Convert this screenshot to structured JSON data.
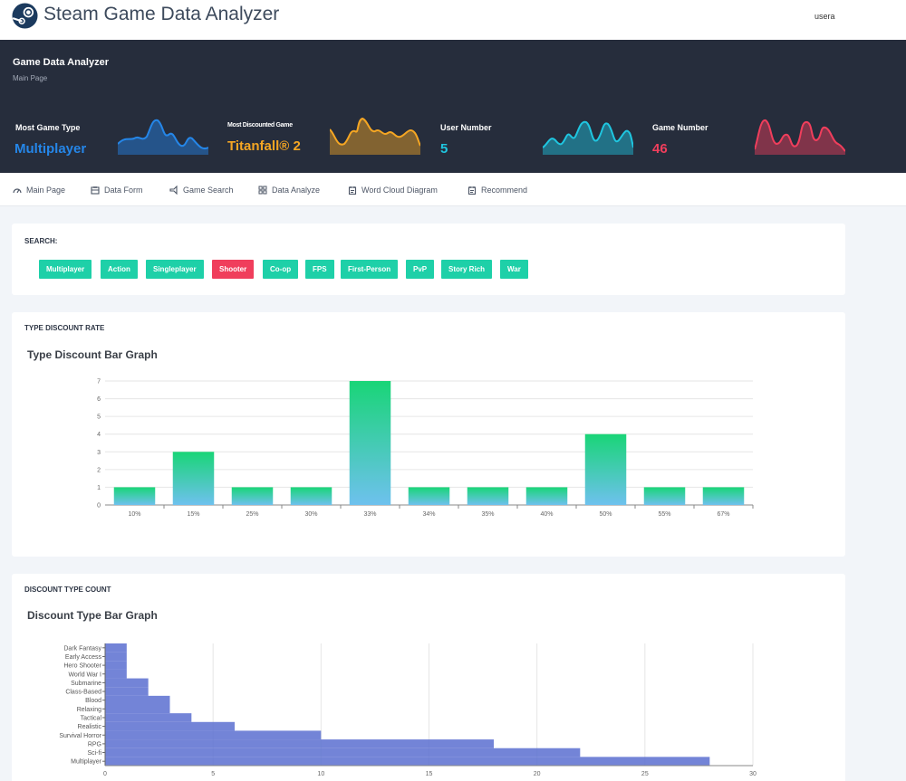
{
  "app": {
    "title": "Steam Game Data Analyzer",
    "user": "usera"
  },
  "hero": {
    "title": "Game Data Analyzer",
    "subtitle": "Main Page",
    "stats": [
      {
        "label": "Most Game Type",
        "value": "Multiplayer",
        "color": "#2586e8"
      },
      {
        "label": "Most Discounted Game",
        "value": "Titanfall® 2",
        "color": "#f5a623"
      },
      {
        "label": "User Number",
        "value": "5",
        "color": "#1fc6e0"
      },
      {
        "label": "Game Number",
        "value": "46",
        "color": "#f03e5c"
      }
    ]
  },
  "nav": [
    {
      "label": "Main Page",
      "icon": "dashboard-icon"
    },
    {
      "label": "Data Form",
      "icon": "form-icon"
    },
    {
      "label": "Game Search",
      "icon": "search-icon"
    },
    {
      "label": "Data Analyze",
      "icon": "grid-icon"
    },
    {
      "label": "Word Cloud Diagram",
      "icon": "calendar-icon"
    },
    {
      "label": "Recommend",
      "icon": "calendar-icon"
    }
  ],
  "search": {
    "heading": "SEARCH:",
    "tags": [
      "Multiplayer",
      "Action",
      "Singleplayer",
      "Shooter",
      "Co-op",
      "FPS",
      "First-Person",
      "PvP",
      "Story Rich",
      "War"
    ],
    "active": "Shooter"
  },
  "discount_card": {
    "heading": "TYPE DISCOUNT RATE",
    "title": "Type Discount Bar Graph"
  },
  "type_card": {
    "heading": "DISCOUNT TYPE COUNT",
    "title": "Discount Type Bar Graph"
  },
  "chart_data": [
    {
      "type": "bar",
      "title": "Type Discount Bar Graph",
      "categories": [
        "10%",
        "15%",
        "25%",
        "30%",
        "33%",
        "34%",
        "35%",
        "40%",
        "50%",
        "55%",
        "67%"
      ],
      "values": [
        1,
        3,
        1,
        1,
        7,
        1,
        1,
        1,
        4,
        1,
        1
      ],
      "ylim": [
        0,
        7
      ],
      "yticks": [
        0,
        1,
        2,
        3,
        4,
        5,
        6,
        7
      ],
      "grid": true,
      "colors": {
        "top": "#19d577",
        "bottom": "#6ec1ee"
      }
    },
    {
      "type": "bar",
      "orientation": "horizontal",
      "title": "Discount Type Bar Graph",
      "categories": [
        "Multiplayer",
        "Sci-fi",
        "RPG",
        "Survival Horror",
        "Realistic",
        "Tactical",
        "Relaxing",
        "Blood",
        "Class-Based",
        "Submarine",
        "World War I",
        "Hero Shooter",
        "Early Access",
        "Dark Fantasy"
      ],
      "values": [
        28,
        22,
        18,
        10,
        6,
        4,
        3,
        3,
        2,
        2,
        1,
        1,
        1,
        1
      ],
      "xlim": [
        0,
        30
      ],
      "xticks": [
        0,
        5,
        10,
        15,
        20,
        25,
        30
      ],
      "grid": true,
      "color": "#5b6fd0"
    }
  ]
}
